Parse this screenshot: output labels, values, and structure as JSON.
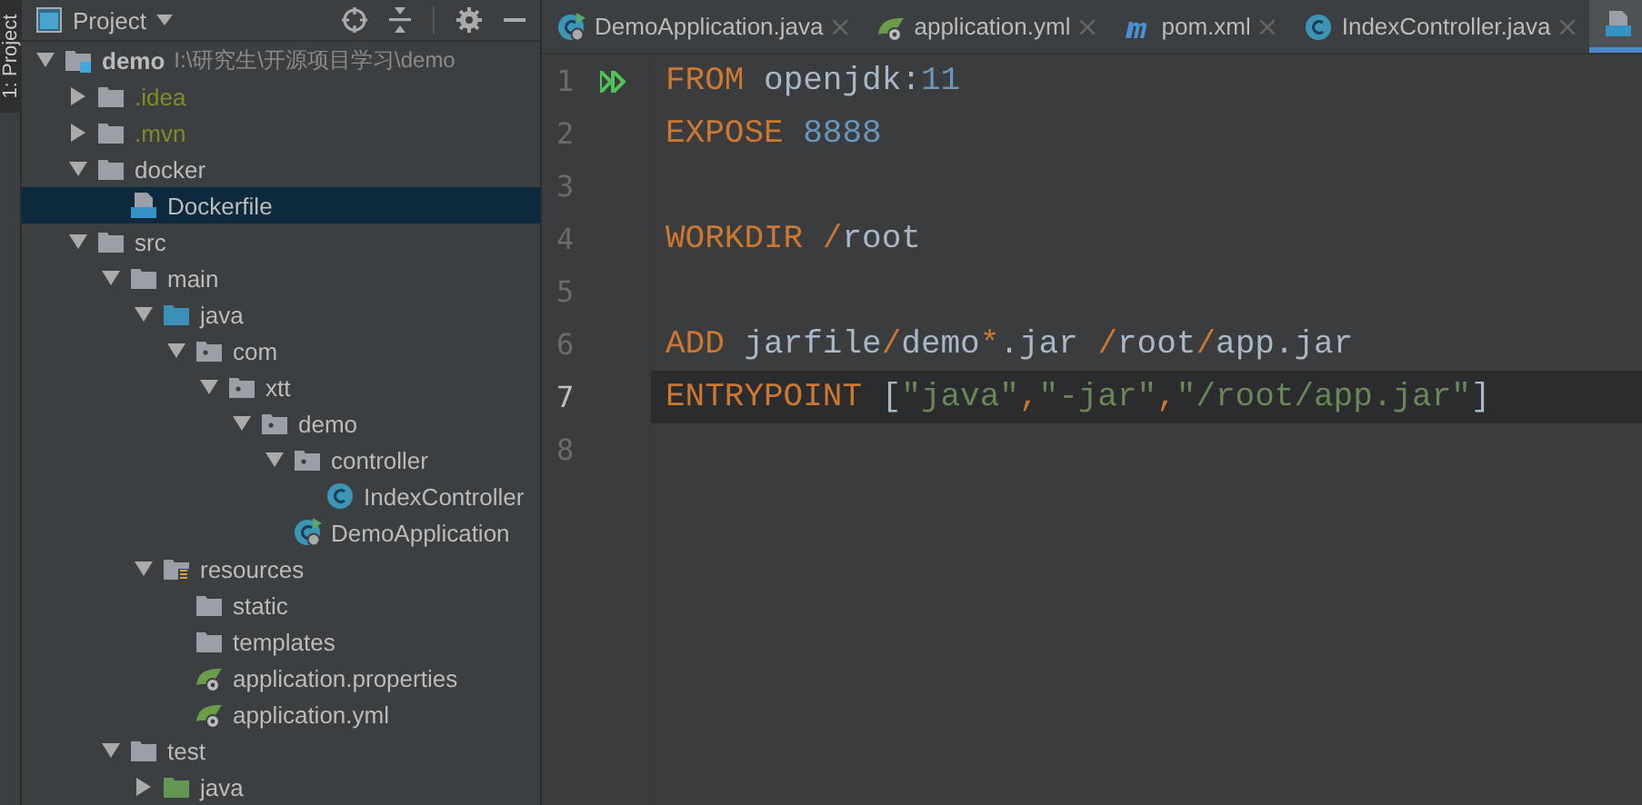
{
  "tool_strip": {
    "label": "1: Project"
  },
  "project_panel": {
    "title": "Project",
    "tree": [
      {
        "label": "demo",
        "path": "I:\\研究生\\开源项目学习\\demo",
        "kind": "module",
        "expanded": true,
        "selected": false,
        "ignored": false,
        "children": [
          {
            "label": ".idea",
            "kind": "folder",
            "expanded": false,
            "selected": false,
            "ignored": true
          },
          {
            "label": ".mvn",
            "kind": "folder",
            "expanded": false,
            "selected": false,
            "ignored": true
          },
          {
            "label": "docker",
            "kind": "folder",
            "expanded": true,
            "selected": false,
            "ignored": false,
            "children": [
              {
                "label": "Dockerfile",
                "kind": "dockerfile",
                "selected": true,
                "ignored": false
              }
            ]
          },
          {
            "label": "src",
            "kind": "folder",
            "expanded": true,
            "selected": false,
            "ignored": false,
            "children": [
              {
                "label": "main",
                "kind": "folder",
                "expanded": true,
                "selected": false,
                "ignored": false,
                "children": [
                  {
                    "label": "java",
                    "kind": "source",
                    "expanded": true,
                    "selected": false,
                    "ignored": false,
                    "children": [
                      {
                        "label": "com",
                        "kind": "package",
                        "expanded": true,
                        "selected": false,
                        "ignored": false,
                        "children": [
                          {
                            "label": "xtt",
                            "kind": "package",
                            "expanded": true,
                            "selected": false,
                            "ignored": false,
                            "children": [
                              {
                                "label": "demo",
                                "kind": "package",
                                "expanded": true,
                                "selected": false,
                                "ignored": false,
                                "children": [
                                  {
                                    "label": "controller",
                                    "kind": "package",
                                    "expanded": true,
                                    "selected": false,
                                    "ignored": false,
                                    "children": [
                                      {
                                        "label": "IndexController",
                                        "kind": "class",
                                        "selected": false,
                                        "ignored": false
                                      }
                                    ]
                                  },
                                  {
                                    "label": "DemoApplication",
                                    "kind": "app",
                                    "selected": false,
                                    "ignored": false
                                  }
                                ]
                              }
                            ]
                          }
                        ]
                      }
                    ]
                  },
                  {
                    "label": "resources",
                    "kind": "resources",
                    "expanded": true,
                    "selected": false,
                    "ignored": false,
                    "children": [
                      {
                        "label": "static",
                        "kind": "folder",
                        "selected": false,
                        "ignored": false
                      },
                      {
                        "label": "templates",
                        "kind": "folder",
                        "selected": false,
                        "ignored": false
                      },
                      {
                        "label": "application.properties",
                        "kind": "config",
                        "selected": false,
                        "ignored": false
                      },
                      {
                        "label": "application.yml",
                        "kind": "config",
                        "selected": false,
                        "ignored": false
                      }
                    ]
                  }
                ]
              },
              {
                "label": "test",
                "kind": "folder",
                "expanded": true,
                "selected": false,
                "ignored": false,
                "children": [
                  {
                    "label": "java",
                    "kind": "test",
                    "expanded": false,
                    "selected": false,
                    "ignored": false
                  }
                ]
              }
            ]
          }
        ]
      }
    ]
  },
  "tabs": [
    {
      "label": "DemoApplication.java",
      "kind": "app",
      "selected": false
    },
    {
      "label": "application.yml",
      "kind": "config",
      "selected": false
    },
    {
      "label": "pom.xml",
      "kind": "maven",
      "selected": false
    },
    {
      "label": "IndexController.java",
      "kind": "class",
      "selected": false
    },
    {
      "kind": "dockerfile",
      "selected": true
    }
  ],
  "editor": {
    "lines": [
      {
        "number": "1",
        "run": true,
        "current": false,
        "tokens": [
          {
            "kind": "keyword",
            "text": "FROM"
          },
          {
            "kind": "plain",
            "text": " openjdk:"
          },
          {
            "kind": "number",
            "text": "11"
          }
        ]
      },
      {
        "number": "2",
        "current": false,
        "tokens": [
          {
            "kind": "keyword",
            "text": "EXPOSE"
          },
          {
            "kind": "number",
            "text": " 8888"
          }
        ]
      },
      {
        "number": "3",
        "current": false
      },
      {
        "number": "4",
        "current": false,
        "tokens": [
          {
            "kind": "keyword",
            "text": "WORKDIR /"
          },
          {
            "kind": "plain",
            "text": "root"
          }
        ]
      },
      {
        "number": "5",
        "current": false
      },
      {
        "number": "6",
        "current": false,
        "tokens": [
          {
            "kind": "keyword",
            "text": "ADD"
          },
          {
            "kind": "plain",
            "text": " jarfile"
          },
          {
            "kind": "keyword",
            "text": "/"
          },
          {
            "kind": "plain",
            "text": "demo"
          },
          {
            "kind": "keyword",
            "text": "*"
          },
          {
            "kind": "plain",
            "text": ".jar "
          },
          {
            "kind": "keyword",
            "text": "/"
          },
          {
            "kind": "plain",
            "text": "root"
          },
          {
            "kind": "keyword",
            "text": "/"
          },
          {
            "kind": "plain",
            "text": "app.jar"
          }
        ]
      },
      {
        "number": "7",
        "current": true,
        "tokens": [
          {
            "kind": "keyword",
            "text": "ENTRYPOINT"
          },
          {
            "kind": "plain",
            "text": " ["
          },
          {
            "kind": "string",
            "text": "\"java\""
          },
          {
            "kind": "keyword",
            "text": ","
          },
          {
            "kind": "string",
            "text": "\"-jar\""
          },
          {
            "kind": "keyword",
            "text": ","
          },
          {
            "kind": "string",
            "text": "\"/root/app.jar\""
          },
          {
            "kind": "plain",
            "text": "]"
          }
        ]
      },
      {
        "number": "8",
        "current": false
      }
    ]
  }
}
